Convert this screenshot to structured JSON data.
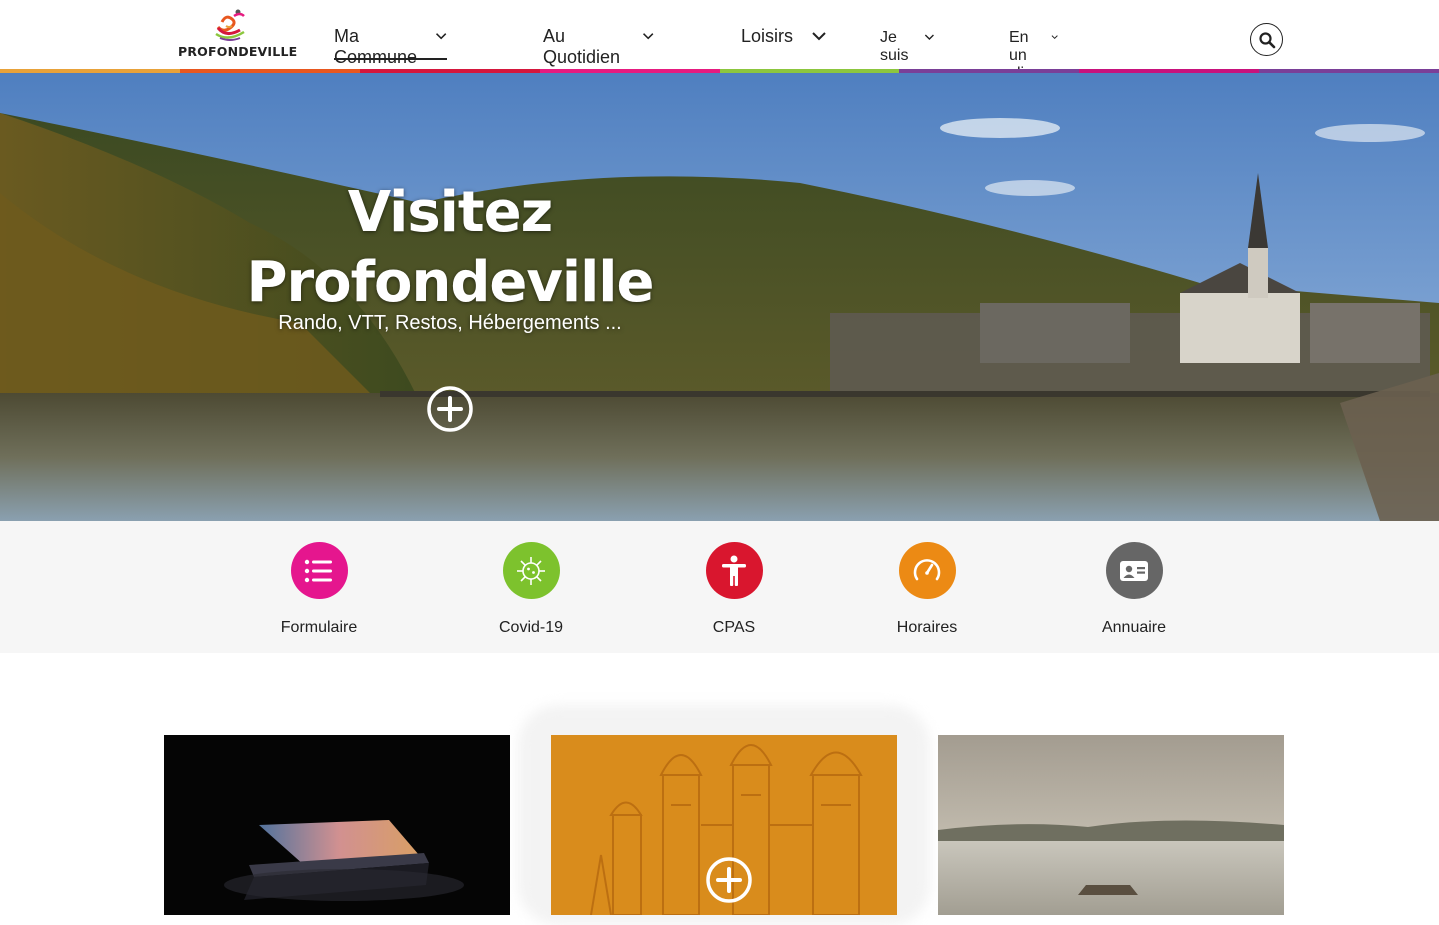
{
  "site": {
    "name": "PROFONDEVILLE"
  },
  "nav": {
    "items": [
      {
        "label": "Ma Commune",
        "active": true
      },
      {
        "label": "Au Quotidien",
        "active": false
      },
      {
        "label": "Loisirs",
        "active": false
      },
      {
        "label": "Je suis",
        "active": false
      },
      {
        "label": "En un clic",
        "active": false
      }
    ],
    "search_icon": "search-icon"
  },
  "colors": {
    "rainbow": [
      "#e8a23a",
      "#e8571f",
      "#d5173d",
      "#e61b80",
      "#8cc63e",
      "#7a3f98",
      "#c8127c",
      "#7a3f98"
    ],
    "formulaire": "#e5168e",
    "covid": "#7dc22d",
    "cpas": "#d9162e",
    "horaires": "#ec8a14",
    "annuaire": "#666666",
    "card_orange": "#d98c1c"
  },
  "hero": {
    "title_line1": "Visitez",
    "title_line2": "Profondeville",
    "subtitle": "Rando, VTT,  Restos, Hébergements ...",
    "more_icon": "plus-circle-icon"
  },
  "quick_links": [
    {
      "label": "Formulaire",
      "icon": "list-icon"
    },
    {
      "label": "Covid-19",
      "icon": "virus-icon"
    },
    {
      "label": "CPAS",
      "icon": "person-icon"
    },
    {
      "label": "Horaires",
      "icon": "gauge-icon"
    },
    {
      "label": "Annuaire",
      "icon": "contact-card-icon"
    }
  ],
  "cards": [
    {
      "image": "laptop-dark"
    },
    {
      "image": "church-domes-orange",
      "more_icon": "plus-circle-icon"
    },
    {
      "image": "lake-pier"
    }
  ]
}
